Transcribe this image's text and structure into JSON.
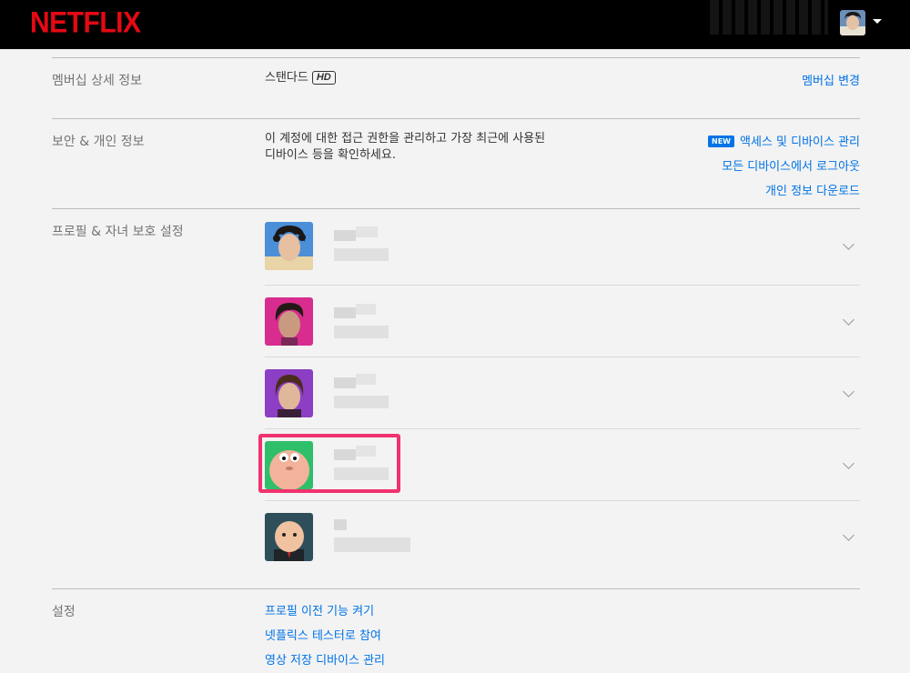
{
  "brand": {
    "logo": "NETFLIX",
    "color": "#e50914"
  },
  "header": {
    "avatar_icon": "profile-avatar-icon",
    "dropdown_icon": "caret-down-icon"
  },
  "membership": {
    "title": "멤버십 상세 정보",
    "plan": "스탠다드",
    "plan_badge": "HD",
    "change_link": "멤버십 변경"
  },
  "security": {
    "title": "보안 & 개인 정보",
    "description_line1": "이 계정에 대한 접근 권한을 관리하고 가장 최근에 사용된",
    "description_line2": "디바이스 등을 확인하세요.",
    "new_badge": "NEW",
    "links": [
      "액세스 및 디바이스 관리",
      "모든 디바이스에서 로그아웃",
      "개인 정보 다운로드"
    ]
  },
  "profiles": {
    "title": "프로필 & 자녀 보호 설정",
    "items": [
      {
        "avatar": "curly-hair-boy-avatar",
        "expand_icon": "chevron-down-icon"
      },
      {
        "avatar": "short-hair-woman-pink-avatar",
        "expand_icon": "chevron-down-icon"
      },
      {
        "avatar": "girl-purple-avatar",
        "expand_icon": "chevron-down-icon"
      },
      {
        "avatar": "baby-green-avatar",
        "expand_icon": "chevron-down-icon",
        "highlighted": true
      },
      {
        "avatar": "boss-baby-avatar",
        "expand_icon": "chevron-down-icon"
      }
    ]
  },
  "settings": {
    "title": "설정",
    "links": [
      "프로필 이전 기능 켜기",
      "넷플릭스 테스터로 참여",
      "영상 저장 디바이스 관리"
    ]
  },
  "colors": {
    "link": "#0073e6",
    "highlight": "#f0326e",
    "background": "#f3f3f3"
  }
}
